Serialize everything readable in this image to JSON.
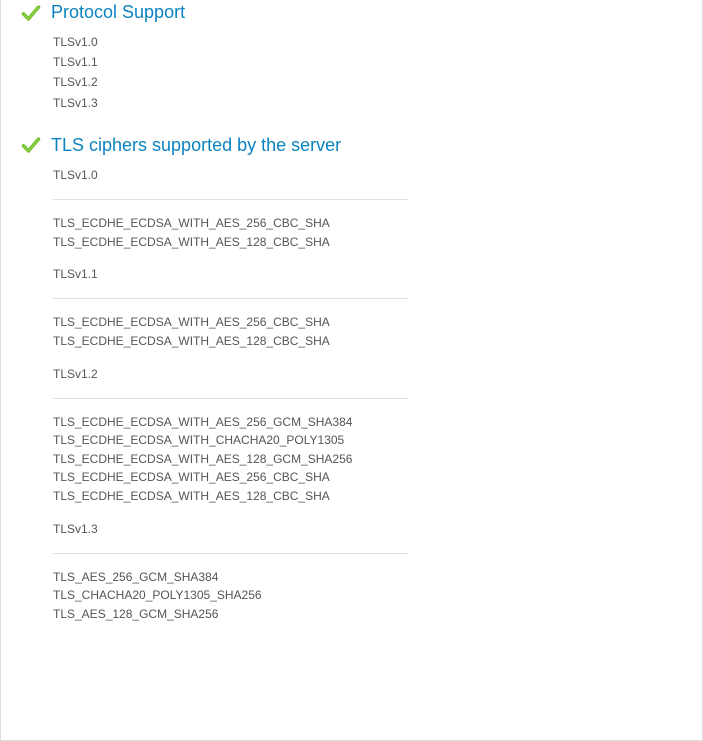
{
  "sections": {
    "protocol_support": {
      "title": "Protocol Support",
      "items": [
        "TLSv1.0",
        "TLSv1.1",
        "TLSv1.2",
        "TLSv1.3"
      ]
    },
    "tls_ciphers": {
      "title": "TLS ciphers supported by the server",
      "groups": [
        {
          "version": "TLSv1.0",
          "ciphers": [
            "TLS_ECDHE_ECDSA_WITH_AES_256_CBC_SHA",
            "TLS_ECDHE_ECDSA_WITH_AES_128_CBC_SHA"
          ]
        },
        {
          "version": "TLSv1.1",
          "ciphers": [
            "TLS_ECDHE_ECDSA_WITH_AES_256_CBC_SHA",
            "TLS_ECDHE_ECDSA_WITH_AES_128_CBC_SHA"
          ]
        },
        {
          "version": "TLSv1.2",
          "ciphers": [
            "TLS_ECDHE_ECDSA_WITH_AES_256_GCM_SHA384",
            "TLS_ECDHE_ECDSA_WITH_CHACHA20_POLY1305",
            "TLS_ECDHE_ECDSA_WITH_AES_128_GCM_SHA256",
            "TLS_ECDHE_ECDSA_WITH_AES_256_CBC_SHA",
            "TLS_ECDHE_ECDSA_WITH_AES_128_CBC_SHA"
          ]
        },
        {
          "version": "TLSv1.3",
          "ciphers": [
            "TLS_AES_256_GCM_SHA384",
            "TLS_CHACHA20_POLY1305_SHA256",
            "TLS_AES_128_GCM_SHA256"
          ]
        }
      ]
    }
  }
}
